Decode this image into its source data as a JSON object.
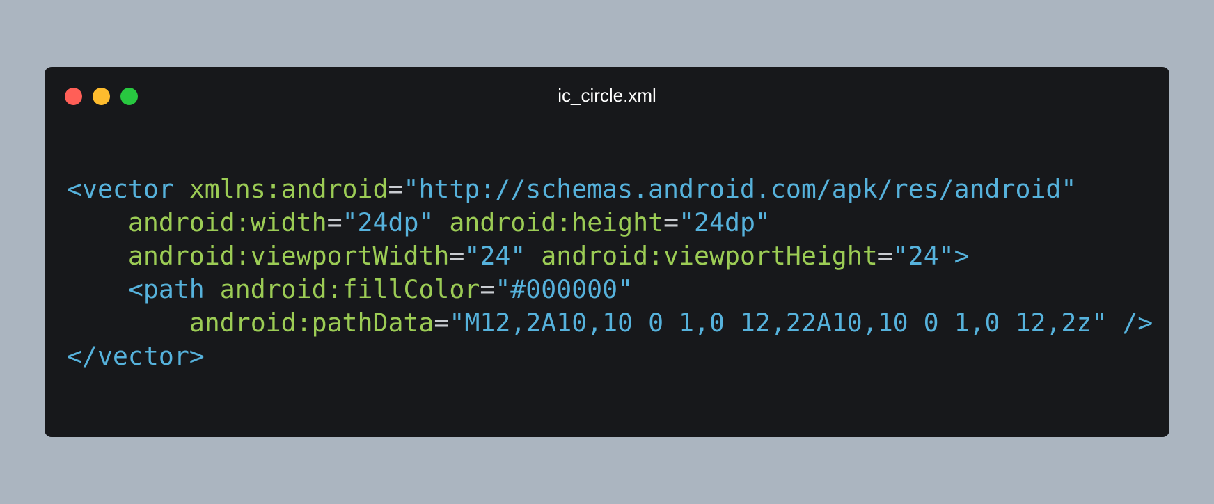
{
  "window": {
    "title": "ic_circle.xml",
    "buttons": {
      "close_color": "#ff5f57",
      "minimize_color": "#febc2e",
      "zoom_color": "#28c840"
    }
  },
  "code": {
    "language": "xml",
    "lines": [
      {
        "indent": "",
        "tokens": [
          {
            "type": "tag",
            "text": "<vector"
          },
          {
            "type": "punct",
            "text": " "
          },
          {
            "type": "attr",
            "text": "xmlns:android"
          },
          {
            "type": "punct",
            "text": "="
          },
          {
            "type": "str",
            "text": "\"http://schemas.android.com/apk/res/android\""
          }
        ]
      },
      {
        "indent": "    ",
        "tokens": [
          {
            "type": "attr",
            "text": "android:width"
          },
          {
            "type": "punct",
            "text": "="
          },
          {
            "type": "str",
            "text": "\"24dp\""
          },
          {
            "type": "punct",
            "text": " "
          },
          {
            "type": "attr",
            "text": "android:height"
          },
          {
            "type": "punct",
            "text": "="
          },
          {
            "type": "str",
            "text": "\"24dp\""
          }
        ]
      },
      {
        "indent": "    ",
        "tokens": [
          {
            "type": "attr",
            "text": "android:viewportWidth"
          },
          {
            "type": "punct",
            "text": "="
          },
          {
            "type": "str",
            "text": "\"24\""
          },
          {
            "type": "punct",
            "text": " "
          },
          {
            "type": "attr",
            "text": "android:viewportHeight"
          },
          {
            "type": "punct",
            "text": "="
          },
          {
            "type": "str",
            "text": "\"24\""
          },
          {
            "type": "tag",
            "text": ">"
          }
        ]
      },
      {
        "indent": "    ",
        "tokens": [
          {
            "type": "tag",
            "text": "<path"
          },
          {
            "type": "punct",
            "text": " "
          },
          {
            "type": "attr",
            "text": "android:fillColor"
          },
          {
            "type": "punct",
            "text": "="
          },
          {
            "type": "str",
            "text": "\"#000000\""
          }
        ]
      },
      {
        "indent": "        ",
        "tokens": [
          {
            "type": "attr",
            "text": "android:pathData"
          },
          {
            "type": "punct",
            "text": "="
          },
          {
            "type": "str",
            "text": "\"M12,2A10,10 0 1,0 12,22A10,10 0 1,0 12,2z\""
          },
          {
            "type": "punct",
            "text": " "
          },
          {
            "type": "tag",
            "text": "/>"
          }
        ]
      },
      {
        "indent": "",
        "tokens": [
          {
            "type": "tag",
            "text": "</vector>"
          }
        ]
      }
    ],
    "colors": {
      "tag": "#56b2dc",
      "attribute": "#9ccc55",
      "string": "#56b2dc",
      "punctuation": "#c9ccd1",
      "background": "#17181b"
    }
  }
}
